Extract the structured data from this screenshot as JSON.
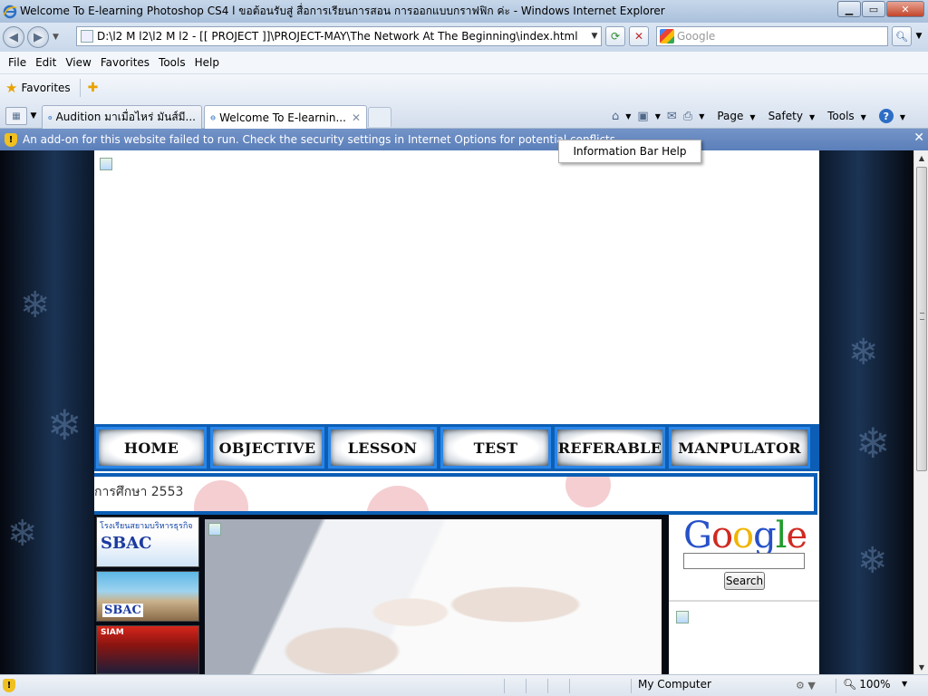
{
  "window": {
    "title": "Welcome To E-learning Photoshop CS4 l ขอต้อนรับสู่ สื่อการเรียนการสอน การออกแบบกราฟฟิก ค่ะ - Windows Internet Explorer",
    "minimize": "▁",
    "maximize": "▭",
    "close": "✕"
  },
  "address": {
    "url": "D:\\l2 M l2\\l2 M l2 - [[ PROJECT ]]\\PROJECT-MAY\\The Network At The Beginning\\index.html",
    "search_placeholder": "Google"
  },
  "menu": [
    "File",
    "Edit",
    "View",
    "Favorites",
    "Tools",
    "Help"
  ],
  "favorites": {
    "label": "Favorites"
  },
  "tabs": [
    {
      "label": "Audition มาเมื่อไหร่ มันส์มี..."
    },
    {
      "label": "Welcome To E-learnin..."
    }
  ],
  "command_bar": {
    "page": "Page",
    "safety": "Safety",
    "tools": "Tools"
  },
  "infobar": {
    "message": "An add-on for this website failed to run. Check the security settings in Internet Options for potential conflicts.",
    "tooltip": "Information Bar Help"
  },
  "site": {
    "nav": [
      "HOME",
      "OBJECTIVE",
      "LESSON",
      "TEST",
      "REFERABLE",
      "MANPULATOR"
    ],
    "marquee": "การศึกษา 2553",
    "banners": {
      "b1_text": "โรงเรียนสยามบริหารธุรกิจ",
      "b1_logo": "SBAC",
      "b2_logo": "SBAC",
      "b3_logo": "SIAM"
    },
    "google": {
      "search_button": "Search"
    }
  },
  "status": {
    "zone": "My Computer",
    "zoom": "100%"
  },
  "colors": {
    "nav_blue": "#0c5eb5",
    "infobar_blue": "#5b7fba"
  }
}
